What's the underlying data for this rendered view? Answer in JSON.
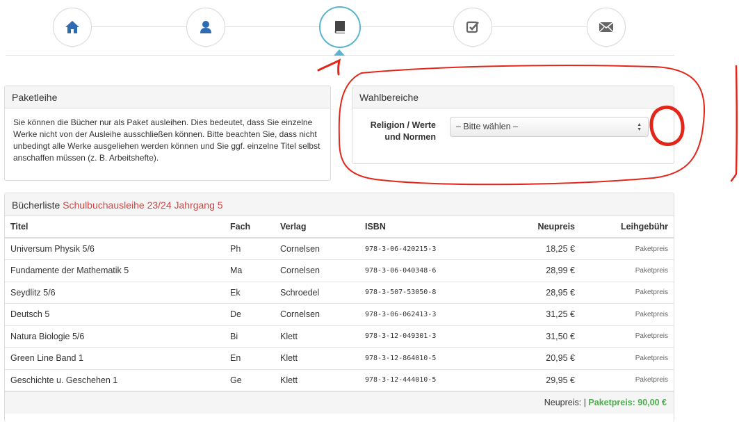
{
  "stepper": {
    "steps": [
      {
        "icon": "home-icon",
        "active": false
      },
      {
        "icon": "user-icon",
        "active": false
      },
      {
        "icon": "book-icon",
        "active": true
      },
      {
        "icon": "check-square-icon",
        "active": false
      },
      {
        "icon": "envelope-icon",
        "active": false
      }
    ],
    "accent_color": "#5bb3cf"
  },
  "paketleihe": {
    "title": "Paketleihe",
    "text": "Sie können die Bücher nur als Paket ausleihen. Dies bedeutet, dass Sie einzelne Werke nicht von der Ausleihe ausschließen können. Bitte beachten Sie, dass nicht unbedingt alle Werke ausgeliehen werden können und Sie ggf. einzelne Titel selbst anschaffen müssen (z. B. Arbeitshefte)."
  },
  "wahlbereiche": {
    "title": "Wahlbereiche",
    "field_label": "Religion / Werte und Normen",
    "select_value": "– Bitte wählen –"
  },
  "buecherliste": {
    "title": "Bücherliste",
    "subtitle": "Schulbuchausleihe 23/24 Jahrgang 5",
    "columns": {
      "title": "Titel",
      "fach": "Fach",
      "verlag": "Verlag",
      "isbn": "ISBN",
      "neupreis": "Neupreis",
      "leihgebuehr": "Leihgebühr"
    },
    "rows": [
      {
        "title": "Universum Physik 5/6",
        "fach": "Ph",
        "verlag": "Cornelsen",
        "isbn": "978-3-06-420215-3",
        "neupreis": "18,25 €",
        "fee": "Paketpreis"
      },
      {
        "title": "Fundamente der Mathematik 5",
        "fach": "Ma",
        "verlag": "Cornelsen",
        "isbn": "978-3-06-040348-6",
        "neupreis": "28,99 €",
        "fee": "Paketpreis"
      },
      {
        "title": "Seydlitz 5/6",
        "fach": "Ek",
        "verlag": "Schroedel",
        "isbn": "978-3-507-53050-8",
        "neupreis": "28,95 €",
        "fee": "Paketpreis"
      },
      {
        "title": "Deutsch 5",
        "fach": "De",
        "verlag": "Cornelsen",
        "isbn": "978-3-06-062413-3",
        "neupreis": "31,25 €",
        "fee": "Paketpreis"
      },
      {
        "title": "Natura Biologie 5/6",
        "fach": "Bi",
        "verlag": "Klett",
        "isbn": "978-3-12-049301-3",
        "neupreis": "31,50 €",
        "fee": "Paketpreis"
      },
      {
        "title": "Green Line Band 1",
        "fach": "En",
        "verlag": "Klett",
        "isbn": "978-3-12-864010-5",
        "neupreis": "20,95 €",
        "fee": "Paketpreis"
      },
      {
        "title": "Geschichte u. Geschehen 1",
        "fach": "Ge",
        "verlag": "Klett",
        "isbn": "978-3-12-444010-5",
        "neupreis": "29,95 €",
        "fee": "Paketpreis"
      }
    ],
    "footer": {
      "neupreis_label": "Neupreis: |",
      "paketpreis": "Paketpreis: 90,00 €"
    }
  },
  "colors": {
    "red_highlight": "#d64541",
    "green_highlight": "#4cae4c",
    "annotation_red": "#e3261a"
  }
}
